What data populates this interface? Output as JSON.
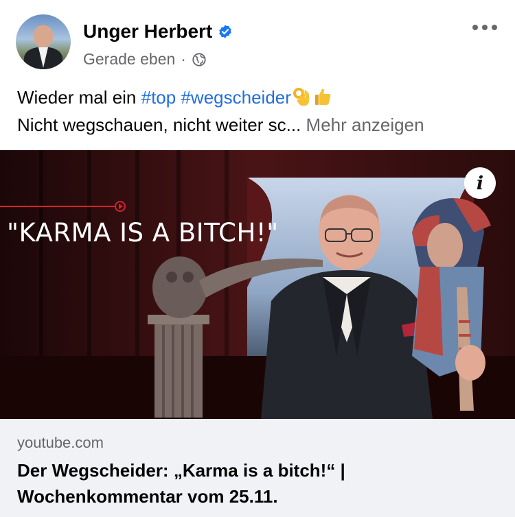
{
  "post": {
    "author": "Unger Herbert",
    "timestamp": "Gerade eben",
    "separator": "·",
    "text_prefix": "Wieder mal ein ",
    "hashtags": [
      "#top",
      "#wegscheider"
    ],
    "line2": "Nicht wegschauen, nicht weiter sc...",
    "more_label": "Mehr anzeigen"
  },
  "media": {
    "overlay_text": "\"KARMA IS A BITCH!\"",
    "info_label": "i"
  },
  "link_preview": {
    "domain": "youtube.com",
    "title_line1": "Der Wegscheider: „Karma is a bitch!“ |",
    "title_line2": "Wochenkommentar vom 25.11."
  },
  "colors": {
    "hashtag": "#216fdb",
    "verified": "#1877f2",
    "secondary_text": "#65676b",
    "link_card_bg": "#f0f2f5"
  },
  "icons": [
    "verified-badge-icon",
    "globe-icon",
    "more-options-icon",
    "ok-hand-emoji-icon",
    "thumbs-up-emoji-icon",
    "info-icon"
  ]
}
